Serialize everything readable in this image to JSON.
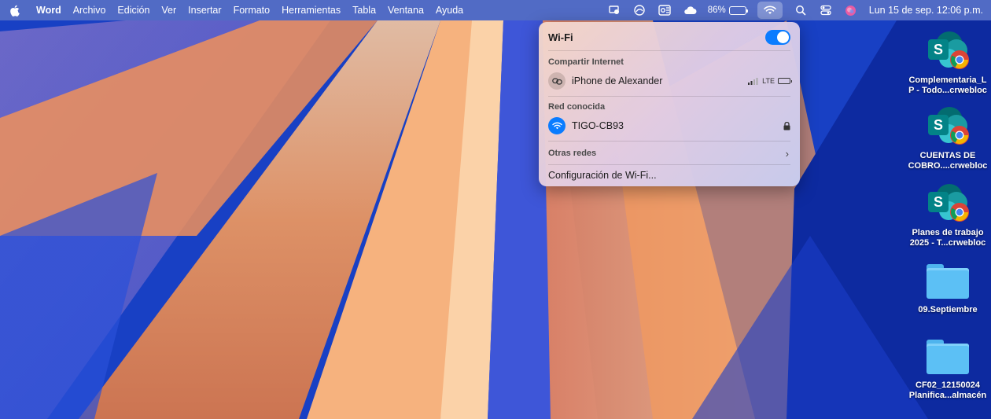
{
  "menubar": {
    "app_name": "Word",
    "menus": [
      "Archivo",
      "Edición",
      "Ver",
      "Insertar",
      "Formato",
      "Herramientas",
      "Tabla",
      "Ventana",
      "Ayuda"
    ],
    "status_icons": [
      "cast-icon",
      "screen-time-icon",
      "outlook-icon",
      "cloud-icon"
    ],
    "battery_percent": "86%",
    "battery_level": 0.86,
    "clock": "Lun 15 de sep.  12:06 p.m."
  },
  "wifi_panel": {
    "title": "Wi-Fi",
    "wifi_enabled": true,
    "hotspot_section": "Compartir Internet",
    "hotspot_name": "iPhone de Alexander",
    "hotspot_network": "LTE",
    "known_section": "Red conocida",
    "known_network": "TIGO-CB93",
    "other_networks": "Otras redes",
    "settings_link": "Configuración de Wi-Fi..."
  },
  "desktop_icons": [
    {
      "label": "Complementaria_L\nP - Todo...crwebloc",
      "type": "sharepoint-chrome"
    },
    {
      "label": "CUENTAS DE\nCOBRO....crwebloc",
      "type": "sharepoint-chrome"
    },
    {
      "label": "Planes de trabajo\n2025 - T...crwebloc",
      "type": "sharepoint-chrome"
    },
    {
      "label": "09.Septiembre",
      "type": "folder"
    },
    {
      "label": "CF02_12150024\nPlanifica...almacén",
      "type": "folder"
    }
  ],
  "colors": {
    "accent": "#0a7cff",
    "wallpaper_blue": "#1a48d0",
    "wallpaper_orange": "#f39a5c",
    "folder": "#5cc0f5"
  }
}
